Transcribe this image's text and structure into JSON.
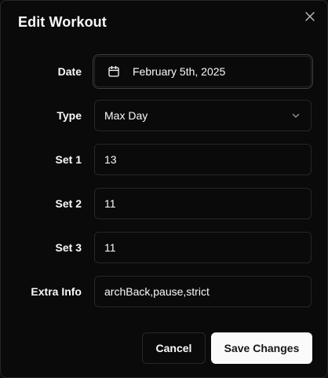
{
  "dialog": {
    "title": "Edit Workout",
    "close_icon": "close-icon"
  },
  "form": {
    "date": {
      "label": "Date",
      "value": "February 5th, 2025",
      "icon": "calendar-icon"
    },
    "type": {
      "label": "Type",
      "value": "Max Day",
      "icon": "chevron-down-icon"
    },
    "set1": {
      "label": "Set 1",
      "value": "13"
    },
    "set2": {
      "label": "Set 2",
      "value": "11"
    },
    "set3": {
      "label": "Set 3",
      "value": "11"
    },
    "extra": {
      "label": "Extra Info",
      "value": "archBack,pause,strict"
    }
  },
  "actions": {
    "cancel_label": "Cancel",
    "save_label": "Save Changes"
  },
  "colors": {
    "background": "#0a0a0a",
    "border": "#27272a",
    "text": "#fafafa",
    "primary_button_bg": "#fafafa",
    "primary_button_text": "#18181b"
  }
}
